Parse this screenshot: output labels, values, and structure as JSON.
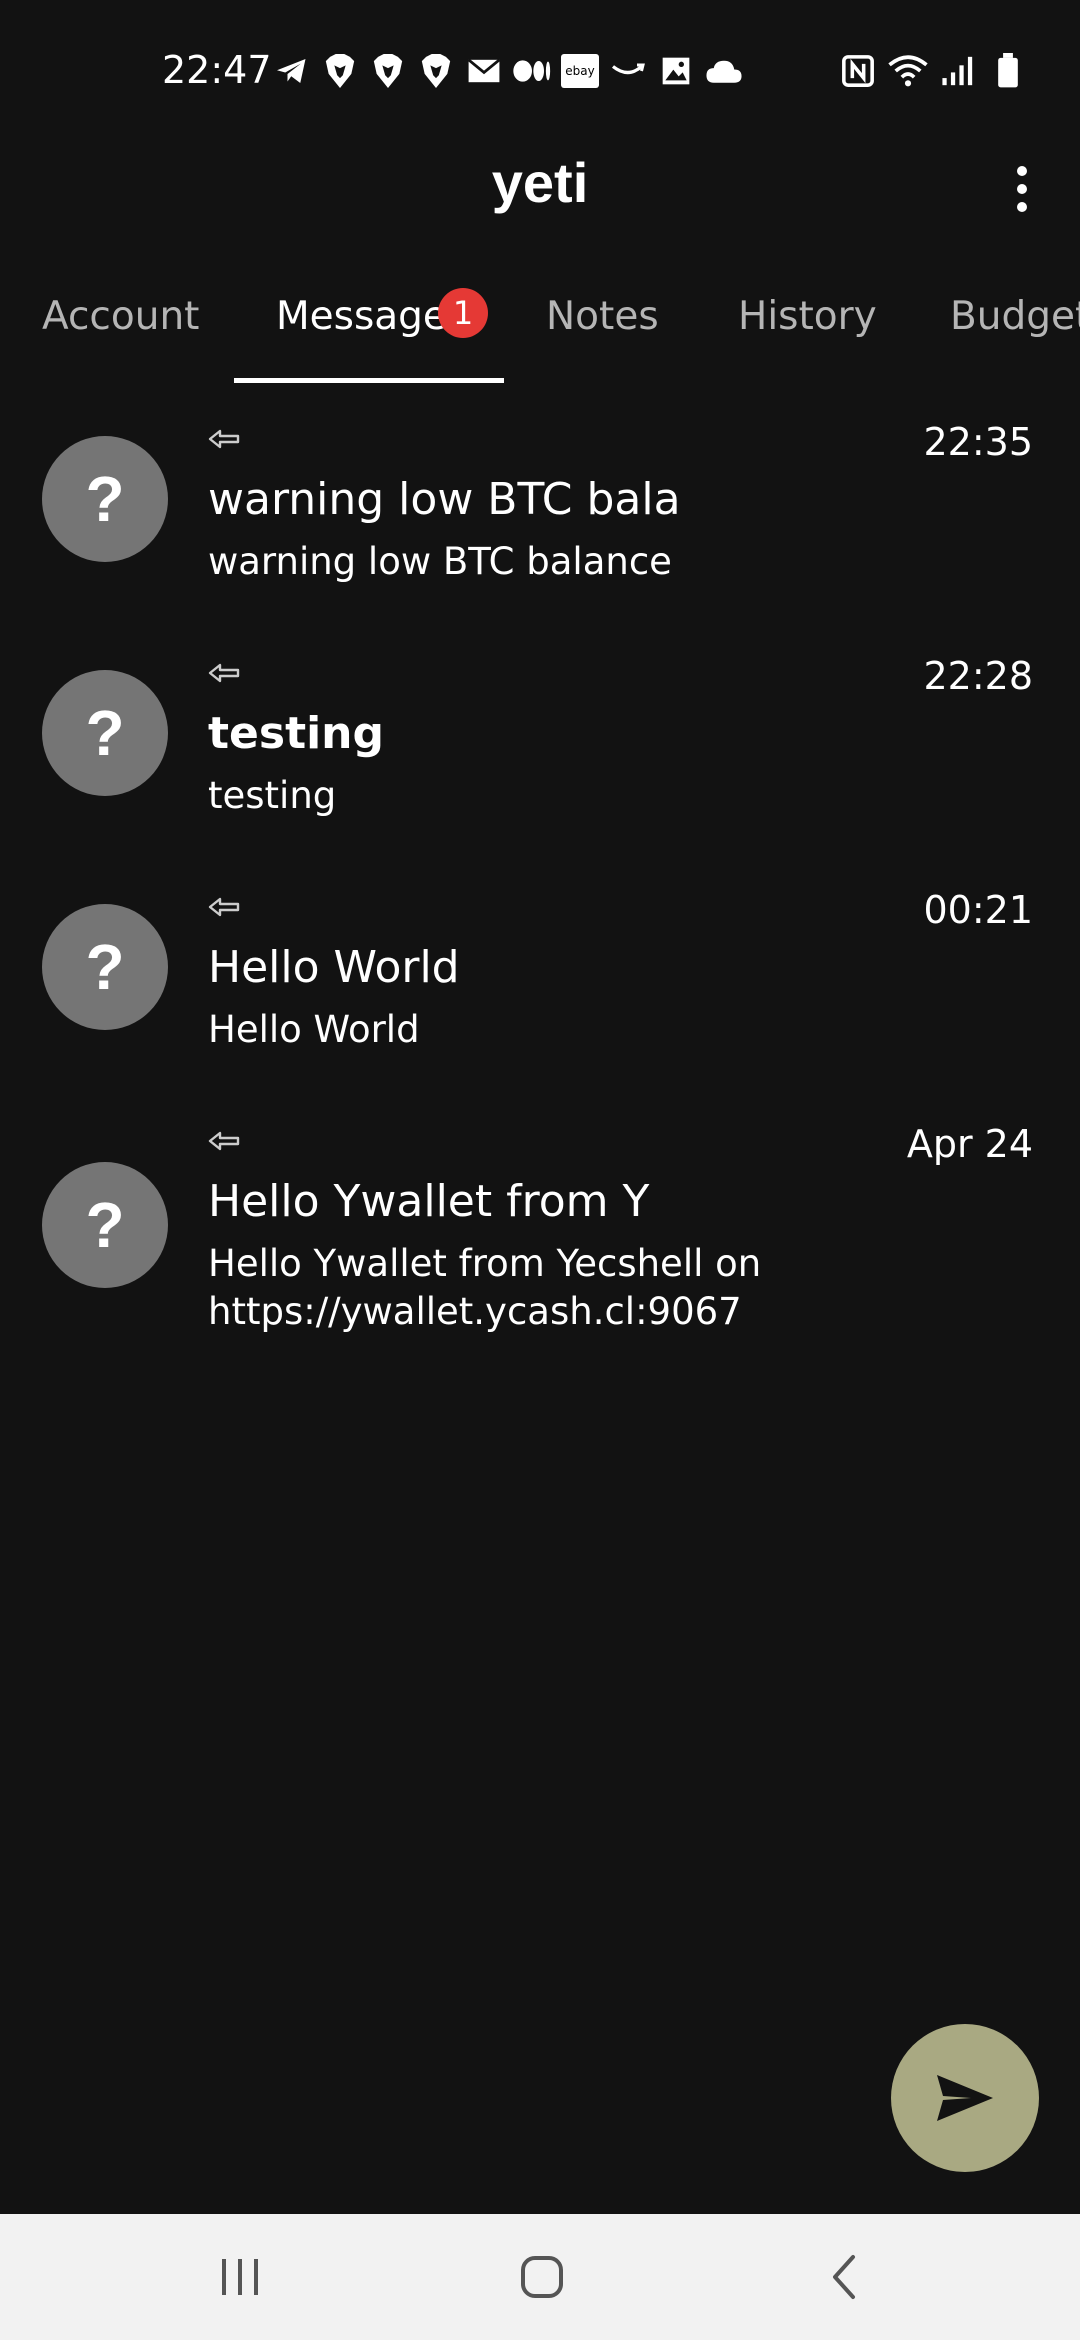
{
  "status_bar": {
    "time": "22:47",
    "left_icons": [
      "telegram-icon",
      "brave-icon",
      "brave-icon",
      "brave-icon",
      "mail-icon",
      "medium-icon",
      "ebay-icon",
      "amazon-icon",
      "gallery-icon",
      "cloud-icon"
    ],
    "ebay_label": "ebay",
    "right_icons": [
      "nfc-icon",
      "wifi-icon",
      "signal-icon",
      "battery-icon"
    ]
  },
  "app_bar": {
    "title": "yeti",
    "menu_icon": "more-vert-icon"
  },
  "tabs": [
    {
      "label": "Account",
      "active": false
    },
    {
      "label": "Messages",
      "active": true
    },
    {
      "label": "Notes",
      "active": false
    },
    {
      "label": "History",
      "active": false
    },
    {
      "label": "Budget",
      "active": false
    }
  ],
  "messages_badge": "1",
  "messages": [
    {
      "avatar": "?",
      "time": "22:35",
      "subject": "warning low BTC bala",
      "body": "warning low BTC balance",
      "unread": false
    },
    {
      "avatar": "?",
      "time": "22:28",
      "subject": "testing",
      "body": "testing",
      "unread": true
    },
    {
      "avatar": "?",
      "time": "00:21",
      "subject": "Hello World",
      "body": "Hello World",
      "unread": false
    },
    {
      "avatar": "?",
      "time": "Apr 24",
      "subject": "Hello Ywallet from Y",
      "body": "Hello Ywallet from Yecshell on https://ywallet.ycash.cl:9067",
      "unread": false
    }
  ],
  "fab": {
    "icon": "send-icon",
    "color": "#a9a982"
  },
  "nav_bar": {
    "buttons": [
      "recent-apps-icon",
      "home-icon",
      "back-icon"
    ]
  },
  "colors": {
    "background": "#121212",
    "avatar": "#757575",
    "badge": "#e53935",
    "nav_background": "#f2f2f2"
  }
}
